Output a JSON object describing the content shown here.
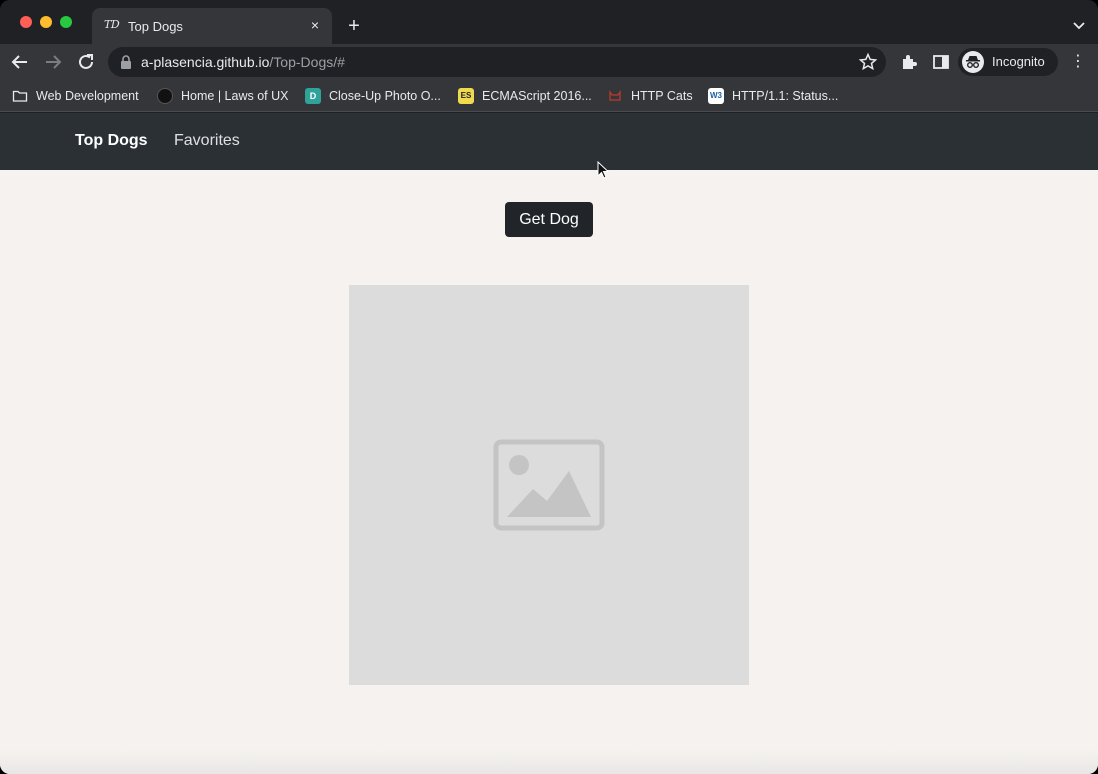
{
  "browser": {
    "tab": {
      "favicon_text": "TD",
      "title": "Top Dogs",
      "close_label": "×"
    },
    "new_tab_label": "+",
    "url": {
      "host": "a-plasencia.github.io",
      "path": "/Top-Dogs/#"
    },
    "profile_label": "Incognito",
    "menu_label": "⋮",
    "bookmarks": [
      {
        "label": "Web Development",
        "icon": "folder-icon"
      },
      {
        "label": "Home | Laws of UX",
        "icon": "lawsofux-favicon-icon"
      },
      {
        "label": "Close-Up Photo O...",
        "icon": "photo-favicon-icon",
        "icon_text": "D"
      },
      {
        "label": "ECMAScript 2016...",
        "icon": "es-favicon-icon",
        "icon_text": "ES"
      },
      {
        "label": "HTTP Cats",
        "icon": "cat-favicon-icon"
      },
      {
        "label": "HTTP/1.1: Status...",
        "icon": "w3c-favicon-icon",
        "icon_text": "W3"
      }
    ]
  },
  "page": {
    "navbar": {
      "brand": "Top Dogs",
      "links": [
        "Favorites"
      ]
    },
    "get_dog_button": "Get Dog",
    "image": {
      "icon": "image-placeholder-icon"
    }
  },
  "colors": {
    "navbar_bg": "#2b3035",
    "button_bg": "#212529",
    "page_bg": "#f5f2ef",
    "placeholder_bg": "#dcdcdc"
  }
}
